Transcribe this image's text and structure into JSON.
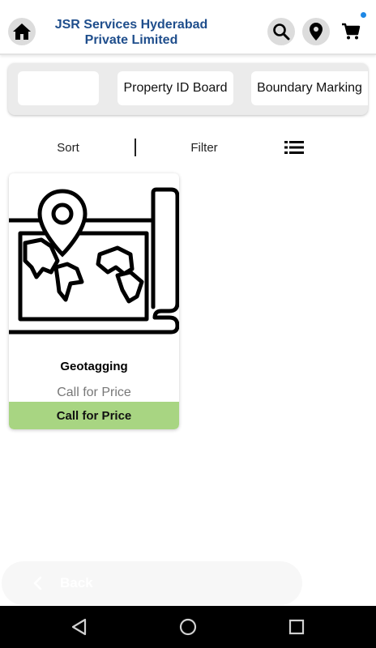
{
  "header": {
    "brand_line1": "JSR Services Hyderabad",
    "brand_line2": "Private Limited",
    "icons": [
      "home-icon",
      "search-icon",
      "location-pin-icon",
      "cart-icon"
    ],
    "colors": {
      "brand": "#1f4e8c",
      "notification_dot": "#1e88e5"
    }
  },
  "categories": [
    {
      "label": ""
    },
    {
      "label": "Property ID Board"
    },
    {
      "label": "Boundary Marking"
    }
  ],
  "toolbar": {
    "sort_label": "Sort",
    "filter_label": "Filter",
    "view_icon": "list-view-icon"
  },
  "products": [
    {
      "name": "Geotagging",
      "price": "Call for Price",
      "cta_label": "Call for Price",
      "image_icon": "map-pin-icon",
      "cta_color": "#a8d582"
    }
  ],
  "back_bar": {
    "label": "Back"
  },
  "system_nav": [
    "back-triangle-icon",
    "home-circle-icon",
    "recents-square-icon"
  ]
}
